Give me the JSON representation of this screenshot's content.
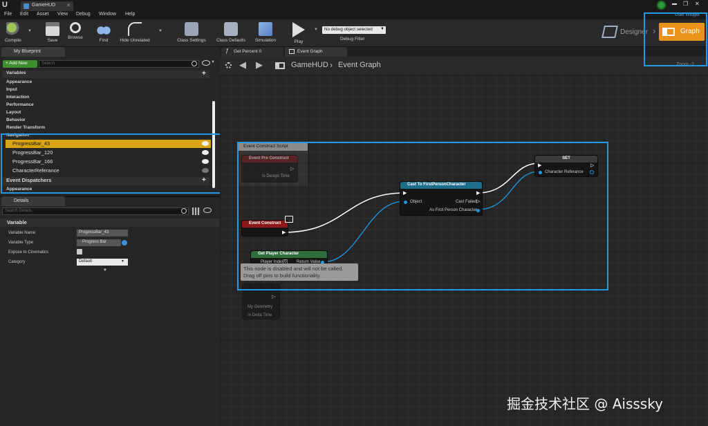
{
  "window": {
    "tab_title": "GameHUD",
    "minimize_glyph": "▬",
    "restore_glyph": "❐",
    "close_glyph": "✕"
  },
  "menu": [
    "File",
    "Edit",
    "Asset",
    "View",
    "Debug",
    "Window",
    "Help"
  ],
  "toolbar": {
    "buttons": [
      "Compile",
      "Save",
      "Browse",
      "Find",
      "Hide Unrelated",
      "Class Settings",
      "Class Defaults",
      "Simulation",
      "Play"
    ],
    "debug_filter_value": "No debug object selected",
    "debug_filter_label": "Debug Filter",
    "designer_label": "Designer",
    "graph_label": "Graph",
    "user_widget_label": "User Widget"
  },
  "my_blueprint": {
    "tab_label": "My Blueprint",
    "add_new_label": "+ Add New",
    "search_placeholder": "Search",
    "variables_label": "Variables",
    "categories": [
      "Appearance",
      "Input",
      "Interaction",
      "Performance",
      "Layout",
      "Behavior",
      "Render Transform",
      "Navigation"
    ],
    "variables": [
      "ProgressBar_43",
      "ProgressBar_120",
      "ProgressBar_166",
      "CharacterReferance"
    ],
    "event_dispatchers_label": "Event Dispatchers",
    "appearance_label": "Appearance"
  },
  "details": {
    "tab_label": "Details",
    "search_placeholder": "Search Details",
    "section_label": "Variable",
    "fields": [
      {
        "label": "Variable Name",
        "value": "ProgressBar_43"
      },
      {
        "label": "Variable Type",
        "value": "Progress Bar"
      },
      {
        "label": "Expose to Cinematics",
        "value": ""
      },
      {
        "label": "Category",
        "value": "Default"
      }
    ]
  },
  "graph_tabs": [
    "Get Percent 0",
    "Event Graph"
  ],
  "breadcrumb": {
    "blueprint": "GameHUD",
    "separator": "›",
    "graph": "Event Graph"
  },
  "zoom_label": "Zoom -2",
  "nodes": {
    "comment": "Event Construct Script",
    "pre_construct": {
      "title": "Event Pre Construct",
      "pin": "Is Design Time"
    },
    "construct": {
      "title": "Event Construct"
    },
    "get_player": {
      "title": "Get Player Character",
      "pin_in": "Player Index",
      "pin_in_value": "0",
      "pin_out": "Return Value"
    },
    "disabled_tooltip": [
      "This node is disabled and will not be called.",
      "Drag off pins to build functionality."
    ],
    "tick": {
      "pin1": "My Geometry",
      "pin2": "In Delta Time"
    },
    "cast": {
      "title": "Cast To FirstPersonCharacter",
      "pin_object": "Object",
      "pin_failed": "Cast Failed",
      "pin_as": "As First Person Character"
    },
    "set": {
      "title": "SET",
      "pin": "Character Referance"
    }
  },
  "watermark": "掘金技术社区 @ Aisssky",
  "colors": {
    "highlight": "#1f9bea",
    "selection": "#d9a412",
    "graph_button": "#e8911b"
  }
}
